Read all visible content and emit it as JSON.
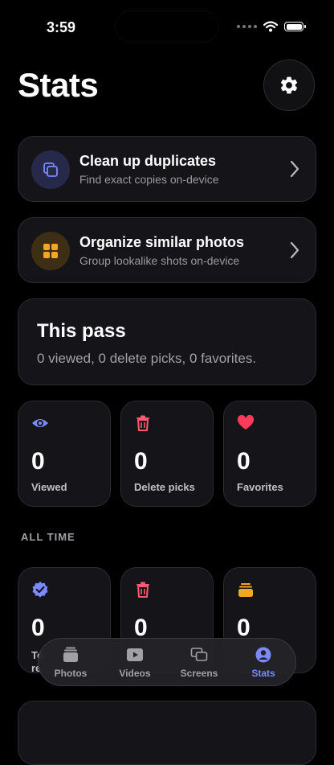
{
  "status_bar": {
    "time": "3:59"
  },
  "page": {
    "title": "Stats"
  },
  "actions": [
    {
      "title": "Clean up duplicates",
      "subtitle": "Find exact copies on-device",
      "icon": "duplicate-icon",
      "color": "#7d8aff"
    },
    {
      "title": "Organize similar photos",
      "subtitle": "Group lookalike shots on-device",
      "icon": "grid-icon",
      "color": "#f5a623"
    }
  ],
  "this_pass": {
    "title": "This pass",
    "summary": "0 viewed, 0 delete picks, 0 favorites.",
    "stats": [
      {
        "value": "0",
        "label": "Viewed",
        "icon": "eye-icon",
        "color": "#7d8aff"
      },
      {
        "value": "0",
        "label": "Delete picks",
        "icon": "trash-icon",
        "color": "#ff5a6e"
      },
      {
        "value": "0",
        "label": "Favorites",
        "icon": "heart-icon",
        "color": "#ff3b5c"
      }
    ]
  },
  "all_time": {
    "label": "ALL TIME",
    "stats": [
      {
        "value": "0",
        "label_fragment_1": "To",
        "label_fragment_2": "re",
        "icon": "verified-badge-icon",
        "color": "#7d8aff"
      },
      {
        "value": "0",
        "icon": "trash-icon",
        "color": "#ff5a6e"
      },
      {
        "value": "0",
        "icon": "stack-icon",
        "color": "#f5a623"
      }
    ]
  },
  "tabs": [
    {
      "label": "Photos",
      "icon": "photos-icon",
      "active": false
    },
    {
      "label": "Videos",
      "icon": "play-icon",
      "active": false
    },
    {
      "label": "Screens",
      "icon": "screens-icon",
      "active": false
    },
    {
      "label": "Stats",
      "icon": "person-icon",
      "active": true
    }
  ],
  "colors": {
    "background": "#000000",
    "card": "#151519",
    "accent": "#7d8aff"
  }
}
